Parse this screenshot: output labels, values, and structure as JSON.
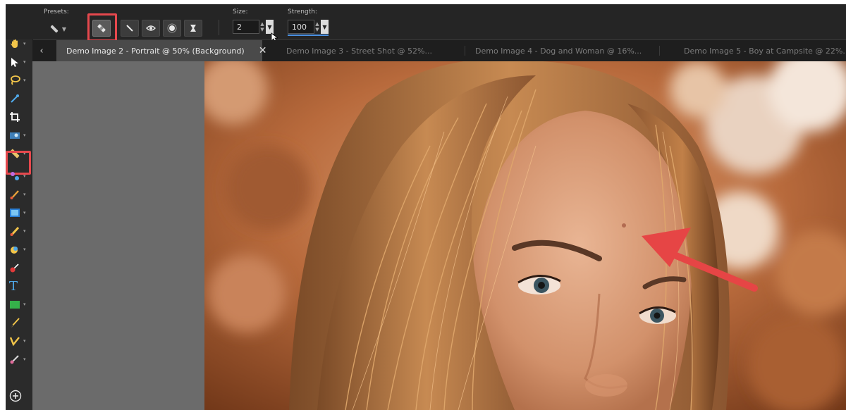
{
  "options_bar": {
    "presets_label": "Presets:",
    "size_label": "Size:",
    "size_value": "2",
    "strength_label": "Strength:",
    "strength_value": "100",
    "tools": [
      "blemish-remover-icon",
      "scratch-remover-icon",
      "red-eye-icon",
      "skin-smoothing-icon",
      "thinify-icon"
    ]
  },
  "tabs": [
    {
      "label": "Demo Image 2 - Portrait @  50% (Background)",
      "active": true
    },
    {
      "label": "Demo Image 3 - Street Shot @  52%..."
    },
    {
      "label": "Demo Image 4 - Dog and Woman @  16%..."
    },
    {
      "label": "Demo Image 5 - Boy at Campsite @  22%..."
    }
  ],
  "tab_close_glyph": "✕",
  "tab_scroll_glyph": "‹",
  "toolbar_items": [
    "pan-icon",
    "pick-icon",
    "lasso-icon",
    "dropper-icon",
    "crop-icon",
    "straighten-icon",
    "makeover-icon",
    "clone-icon",
    "paint-brush-icon",
    "fill-icon",
    "eraser-icon",
    "retouch-icon",
    "red-eye-brush-icon",
    "text-icon",
    "rectangle-shape-icon",
    "pen-icon",
    "draw-icon",
    "color-replace-icon",
    "add-icon"
  ],
  "text_tool_glyph": "T",
  "accent_colors": {
    "highlight": "#e5484d",
    "blue": "#4a90e2",
    "bar": "#252525"
  }
}
